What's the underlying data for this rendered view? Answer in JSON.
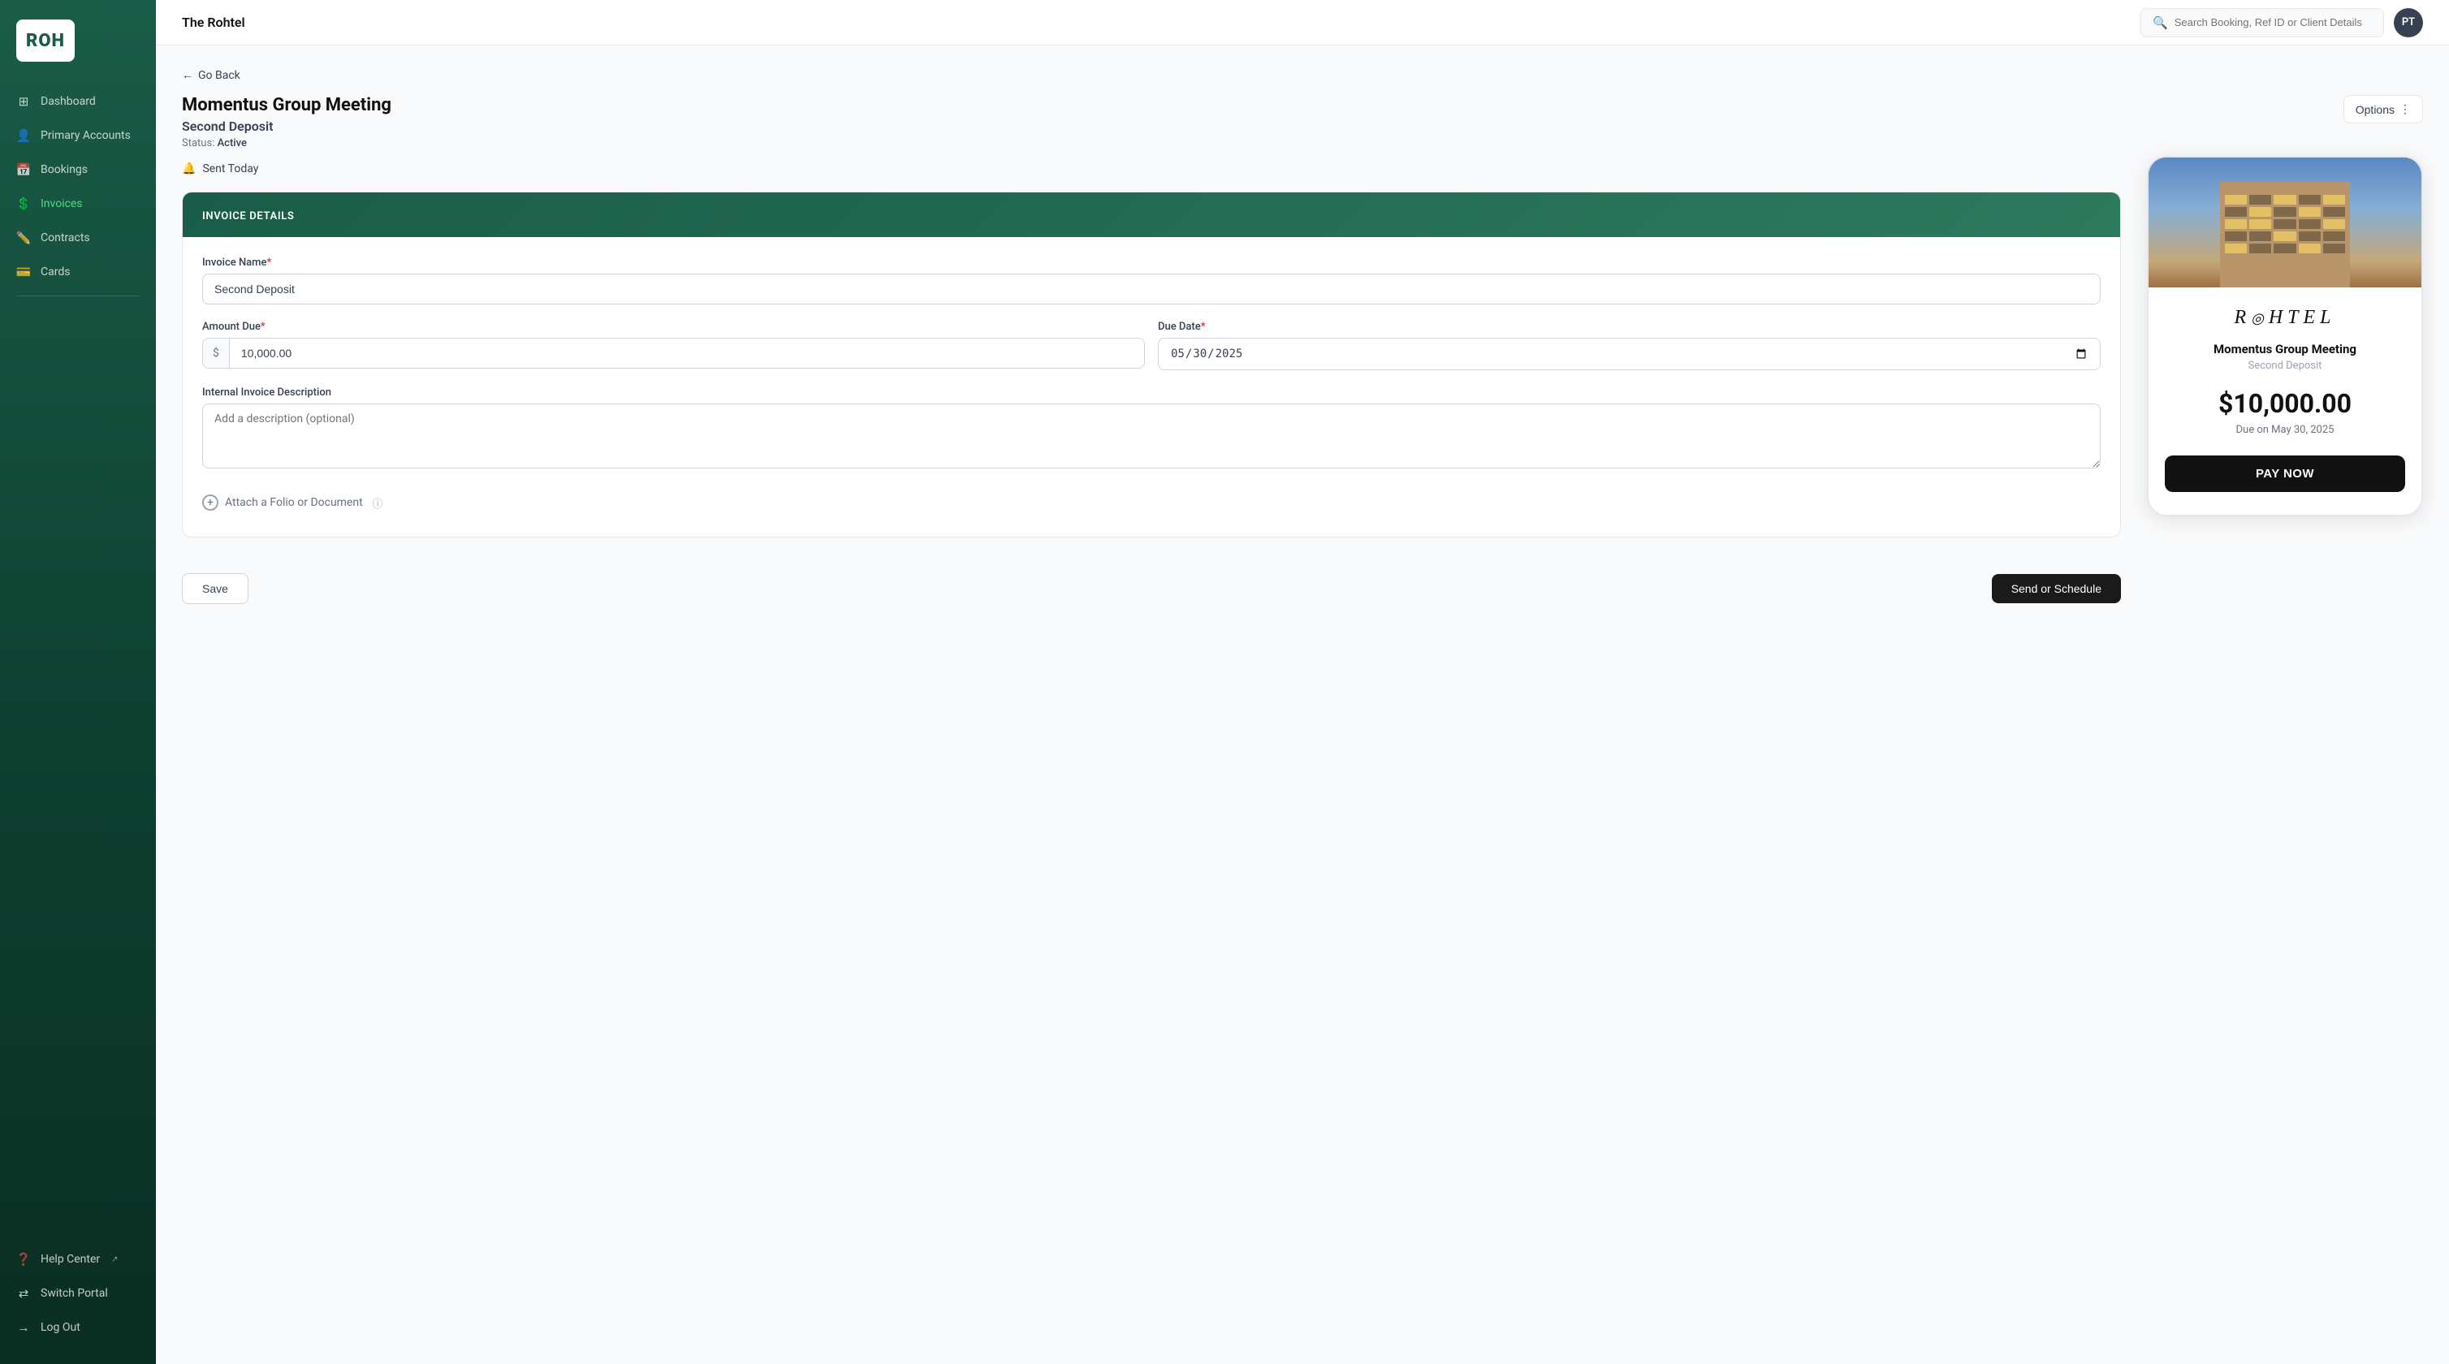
{
  "app": {
    "logo": "ROH",
    "hotel_name": "The Rohtel",
    "avatar_initials": "PT"
  },
  "search": {
    "placeholder": "Search Booking, Ref ID or Client Details"
  },
  "sidebar": {
    "items": [
      {
        "id": "dashboard",
        "label": "Dashboard",
        "icon": "grid",
        "active": false
      },
      {
        "id": "primary-accounts",
        "label": "Primary Accounts",
        "icon": "users",
        "active": false
      },
      {
        "id": "bookings",
        "label": "Bookings",
        "icon": "calendar",
        "active": false
      },
      {
        "id": "invoices",
        "label": "Invoices",
        "icon": "circle-dollar",
        "active": true
      },
      {
        "id": "contracts",
        "label": "Contracts",
        "icon": "edit",
        "active": false
      },
      {
        "id": "cards",
        "label": "Cards",
        "icon": "credit-card",
        "active": false
      }
    ],
    "bottom_items": [
      {
        "id": "help-center",
        "label": "Help Center",
        "icon": "help-circle",
        "external": true
      },
      {
        "id": "switch-portal",
        "label": "Switch Portal",
        "icon": "switch",
        "active": false
      },
      {
        "id": "log-out",
        "label": "Log Out",
        "icon": "logout",
        "active": false
      }
    ]
  },
  "page": {
    "back_label": "Go Back",
    "booking_name": "Momentus Group Meeting",
    "invoice_title": "Second Deposit",
    "status_label": "Status:",
    "status_value": "Active",
    "options_label": "Options",
    "sent_today_label": "Sent Today"
  },
  "invoice_form": {
    "section_title": "INVOICE DETAILS",
    "name_label": "Invoice Name",
    "name_required": true,
    "name_value": "Second Deposit",
    "amount_label": "Amount Due",
    "amount_required": true,
    "amount_value": "10,000.00",
    "amount_prefix": "$",
    "due_date_label": "Due Date",
    "due_date_required": true,
    "due_date_value": "05/30/2025",
    "description_label": "Internal Invoice Description",
    "description_placeholder": "Add a description (optional)",
    "attach_label": "Attach a Folio or Document"
  },
  "actions": {
    "save_label": "Save",
    "send_label": "Send or Schedule"
  },
  "preview_card": {
    "booking_name": "Momentus Group Meeting",
    "invoice_name": "Second Deposit",
    "amount": "$10,000.00",
    "due_label": "Due on May 30, 2025",
    "pay_label": "PAY NOW",
    "logo_text": "ROHTEL"
  }
}
